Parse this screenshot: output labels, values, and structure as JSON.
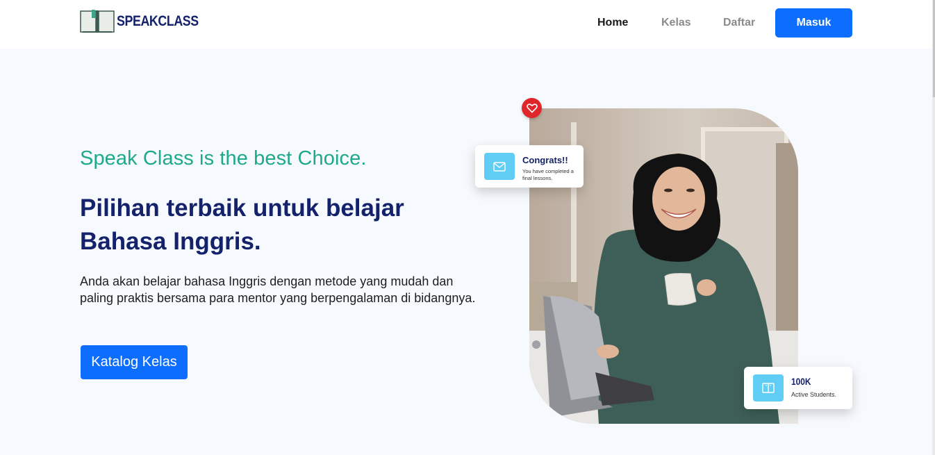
{
  "brand": {
    "name": "SPEAKCLASS"
  },
  "nav": {
    "home": "Home",
    "kelas": "Kelas",
    "daftar": "Daftar",
    "masuk": "Masuk"
  },
  "hero": {
    "tagline": "Speak Class is the best Choice.",
    "headline": "Pilihan terbaik untuk belajar Bahasa Inggris.",
    "description": "Anda akan belajar bahasa Inggris dengan metode yang mudah dan paling praktis bersama para mentor yang berpengalaman di bidangnya.",
    "cta": "Katalog Kelas"
  },
  "cards": {
    "congrats": {
      "title": "Congrats!!",
      "subtitle": "You have completed a final lessons.",
      "icon": "mail-icon"
    },
    "students": {
      "title": "100K",
      "subtitle": "Active Students.",
      "icon": "book-icon"
    }
  },
  "colors": {
    "primary": "#0d6efd",
    "navy": "#13226a",
    "teal": "#1ea98a",
    "heart": "#e0262b",
    "icon_bg": "#60cdf5"
  }
}
